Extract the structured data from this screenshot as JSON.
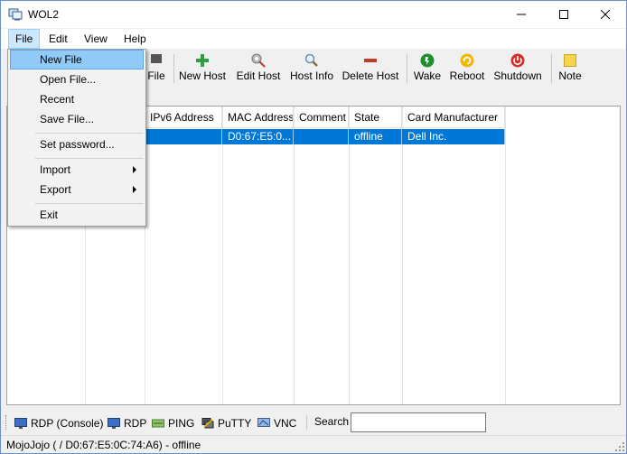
{
  "window": {
    "title": "WOL2"
  },
  "menubar": {
    "items": [
      "File",
      "Edit",
      "View",
      "Help"
    ]
  },
  "file_menu": {
    "items": [
      {
        "label": "New File",
        "submenu": false
      },
      {
        "label": "Open File...",
        "submenu": false
      },
      {
        "label": "Recent",
        "submenu": false
      },
      {
        "label": "Save File...",
        "submenu": false
      },
      {
        "label": "Set password...",
        "submenu": false
      },
      {
        "label": "Import",
        "submenu": true
      },
      {
        "label": "Export",
        "submenu": true
      },
      {
        "label": "Exit",
        "submenu": false
      }
    ]
  },
  "toolbar": {
    "partial_label": "File",
    "buttons": [
      {
        "label": "New Host",
        "icon": "plus-icon"
      },
      {
        "label": "Edit Host",
        "icon": "edit-icon"
      },
      {
        "label": "Host Info",
        "icon": "magnifier-icon"
      },
      {
        "label": "Delete Host",
        "icon": "delete-icon"
      },
      {
        "label": "Wake",
        "icon": "wake-icon"
      },
      {
        "label": "Reboot",
        "icon": "reboot-icon"
      },
      {
        "label": "Shutdown",
        "icon": "shutdown-icon"
      },
      {
        "label": "Note",
        "icon": "note-icon"
      }
    ]
  },
  "table": {
    "columns": [
      "IPv6 Address",
      "MAC Address",
      "Comment",
      "State",
      "Card Manufacturer"
    ],
    "rows": [
      {
        "ipv6": "",
        "mac": "D0:67:E5:0...",
        "comment": "",
        "state": "offline",
        "manufacturer": "Dell Inc."
      }
    ]
  },
  "bottom_toolbar": {
    "buttons": [
      {
        "label": "RDP (Console)",
        "icon": "monitor-icon"
      },
      {
        "label": "RDP",
        "icon": "monitor-icon"
      },
      {
        "label": "PING",
        "icon": "ping-icon"
      },
      {
        "label": "PuTTY",
        "icon": "putty-icon"
      },
      {
        "label": "VNC",
        "icon": "vnc-icon"
      }
    ],
    "search_label": "Search",
    "search_value": ""
  },
  "status": {
    "text": "MojoJojo ( / D0:67:E5:0C:74:A6) - offline"
  },
  "colors": {
    "selection": "#0078d7",
    "menu_hover": "#91c9f7",
    "menu_active": "#cce8ff"
  }
}
